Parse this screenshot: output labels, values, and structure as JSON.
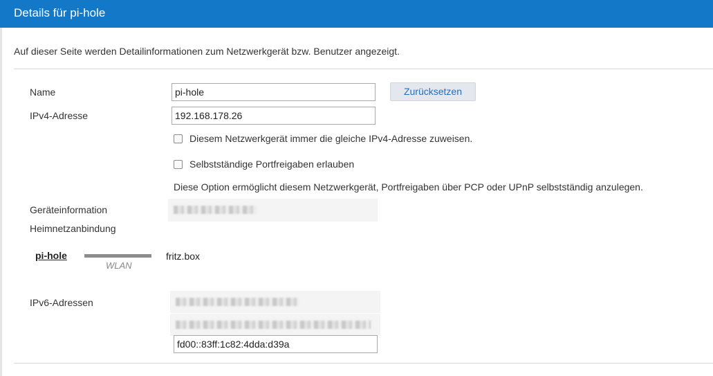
{
  "header": {
    "title": "Details für pi-hole"
  },
  "intro": "Auf dieser Seite werden Detailinformationen zum Netzwerkgerät bzw. Benutzer angezeigt.",
  "form": {
    "name_label": "Name",
    "name_value": "pi-hole",
    "reset_button": "Zurücksetzen",
    "ipv4_label": "IPv4-Adresse",
    "ipv4_value": "192.168.178.26",
    "checkbox_same_ip": {
      "label": "Diesem Netzwerkgerät immer die gleiche IPv4-Adresse zuweisen.",
      "checked": false
    },
    "checkbox_portfreigabe": {
      "label": "Selbstständige Portfreigaben erlauben",
      "checked": false
    },
    "portfreigabe_note": "Diese Option ermöglicht diesem Netzwerkgerät, Portfreigaben über PCP oder UPnP selbstständig anzulegen.",
    "geraeteinfo_label": "Geräteinformation",
    "heimnetz_label": "Heimnetzanbindung"
  },
  "connection": {
    "device": "pi-hole",
    "medium": "WLAN",
    "target": "fritz.box"
  },
  "ipv6": {
    "label": "IPv6-Adressen",
    "visible_address": "fd00::83ff:1c82:4dda:d39a"
  }
}
